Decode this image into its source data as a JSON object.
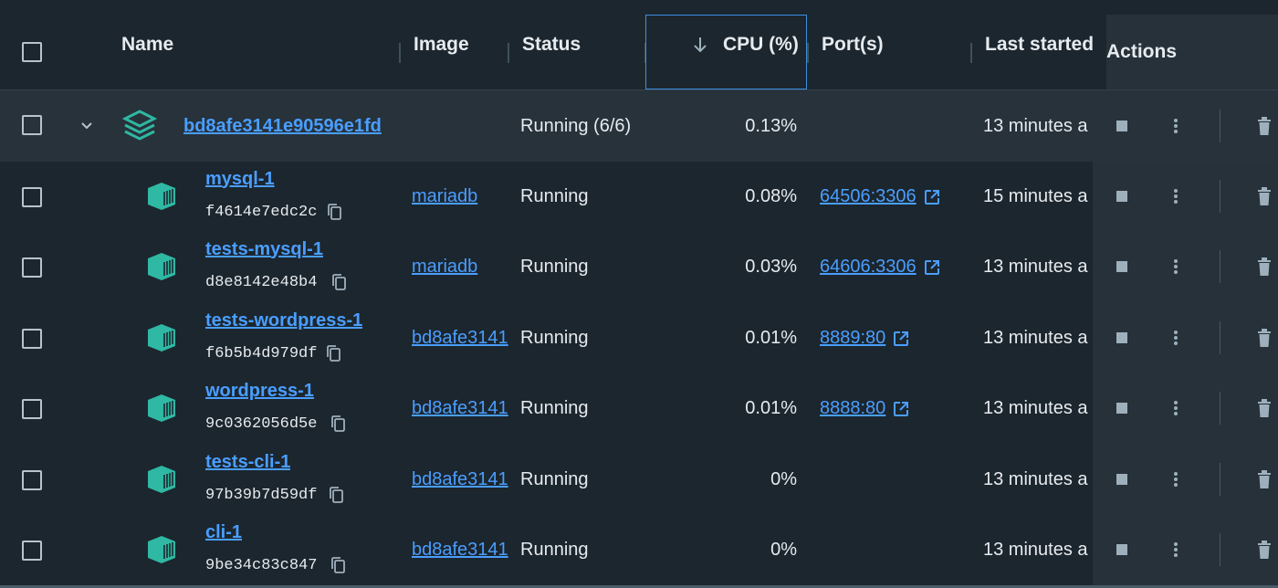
{
  "header": {
    "name": "Name",
    "image": "Image",
    "status": "Status",
    "cpu": "CPU (%)",
    "ports": "Port(s)",
    "last_started": "Last started",
    "actions": "Actions"
  },
  "group": {
    "name": "bd8afe3141e90596e1fd",
    "status": "Running (6/6)",
    "cpu": "0.13%",
    "last_started": "13 minutes a"
  },
  "rows": [
    {
      "name": "mysql-1",
      "id": "f4614e7edc2c",
      "image": "mariadb",
      "status": "Running",
      "cpu": "0.08%",
      "port": "64506:3306",
      "last_started": "15 minutes a"
    },
    {
      "name": "tests-mysql-1",
      "id": "d8e8142e48b4",
      "image": "mariadb",
      "status": "Running",
      "cpu": "0.03%",
      "port": "64606:3306",
      "last_started": "13 minutes a"
    },
    {
      "name": "tests-wordpress-1",
      "id": "f6b5b4d979df",
      "image": "bd8afe3141",
      "status": "Running",
      "cpu": "0.01%",
      "port": "8889:80",
      "last_started": "13 minutes a"
    },
    {
      "name": "wordpress-1",
      "id": "9c0362056d5e",
      "image": "bd8afe3141",
      "status": "Running",
      "cpu": "0.01%",
      "port": "8888:80",
      "last_started": "13 minutes a"
    },
    {
      "name": "tests-cli-1",
      "id": "97b39b7d59df",
      "image": "bd8afe3141",
      "status": "Running",
      "cpu": "0%",
      "port": "",
      "last_started": "13 minutes a"
    },
    {
      "name": "cli-1",
      "id": "9be34c83c847",
      "image": "bd8afe3141",
      "status": "Running",
      "cpu": "0%",
      "port": "",
      "last_started": "13 minutes a"
    }
  ],
  "icons": {
    "stack": "stack-icon",
    "container": "container-icon",
    "copy": "copy-icon",
    "external": "external-link-icon",
    "stop": "stop-icon",
    "more": "more-vertical-icon",
    "delete": "trash-icon",
    "sort": "arrow-down-icon",
    "chevron": "chevron-down-icon"
  },
  "colors": {
    "background": "#1c262e",
    "group_row": "#27323b",
    "link": "#4a9eff",
    "container_icon": "#2fb8a3"
  }
}
